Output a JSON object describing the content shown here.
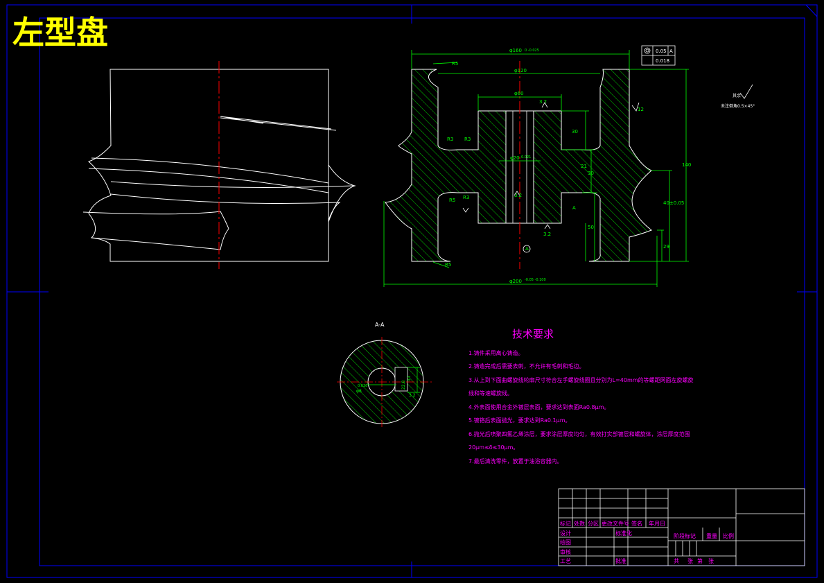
{
  "drawing": {
    "title": "左型盘",
    "colors": {
      "frame": "#0000ff",
      "outline": "#ffffff",
      "dimension": "#00ff00",
      "center_line": "#ff0000",
      "text_magenta": "#ff00ff",
      "title_yellow": "#ffff00"
    }
  },
  "dimensions": {
    "top_overall": "φ160",
    "top_overall_tol": "0 -0.025",
    "r5_top": "R5",
    "d120": "φ120",
    "d60": "φ60",
    "rough_32_a": "3.2",
    "rough_32_b": "3.2",
    "rough_32_c": "3.2",
    "r12_right": "12",
    "r3_a": "R3",
    "r3_b": "R3",
    "r3_c": "R5",
    "r3_d": "R3",
    "d20": "φ20",
    "d20_tol": "0.021",
    "v30": "30",
    "v21": "21",
    "v30b": "30",
    "v50": "50",
    "v29": "29",
    "v140": "140",
    "v40": "40±0.05",
    "bottom_overall": "φ200",
    "bottom_overall_tol": "-0.05 -0.100",
    "r5_bottom": "R5",
    "label_a": "A",
    "label_a_circle": "A"
  },
  "tolerance_frame": {
    "row1_value": "0.05",
    "row1_datum": "A",
    "row2_value": "0.018"
  },
  "roughness_note": {
    "symbol_label": "其余",
    "chamfer_note": "未注倒角0.5×45°"
  },
  "section": {
    "label": "A-A",
    "d_small": "φ8",
    "d_small_tol": "0.036",
    "dim_width": "22.8",
    "dim_width_tol": "0.1",
    "rough": "3.2"
  },
  "tech_requirements": {
    "heading": "技术要求",
    "lines": [
      "1.铸件采用离心铸造。",
      "2.铸造完成后需要去刺，不允许有毛刺和毛边。",
      "3.从上到下面曲螺旋线轮廓尺寸符合左手螺旋线圈且分别为L=40mm的等螺距网面左旋螺旋",
      "线和等速螺旋线。",
      "4.外表面使用合金外镀层表面，要求达到表面Ra0.8μm。",
      "5.镀铬后表面抛光，要求达到Ra0.1μm。",
      "6.抛光后喷聚四氟乙烯涂层，要求涂层厚度均匀，有效打实部镀层和螺旋体，涂层厚度范围",
      "20μm≤δ≤30μm。",
      "7.最后清洗零件，放置于油浴容器内。"
    ]
  },
  "title_block": {
    "h_mark": "标记",
    "h_count": "处数",
    "h_zone": "分区",
    "h_doc": "更改文件号",
    "h_sign": "签名",
    "h_date": "年月日",
    "r_design": "设计",
    "r_std": "标准化",
    "r_draw": "绘图",
    "r_check": "审核",
    "r_process": "工艺",
    "r_approve": "批准",
    "stage_mark": "阶段标记",
    "weight": "重量",
    "scale": "比例",
    "sheet_total": "共",
    "sheet_unit": "张",
    "sheet_no": "第",
    "sheet_unit2": "张"
  }
}
